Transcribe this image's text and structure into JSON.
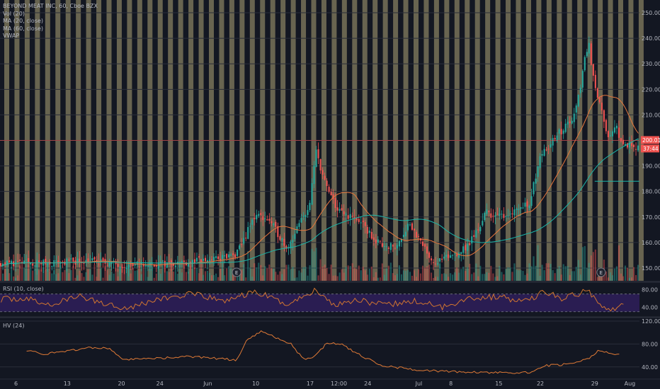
{
  "legend": {
    "symbol": "BEYOND MEAT INC, 60, Cboe BZX",
    "vol": "Vol (20)",
    "ma20": "MA (20, close)",
    "ma60": "MA (60, close)",
    "vwap": "VWAP"
  },
  "panels": {
    "rsi_label": "RSI (10, close)",
    "hv_label": "HV (24)"
  },
  "price_tags": {
    "last": "200.01",
    "countdown": "37:44"
  },
  "earnings_marker": "E",
  "colors": {
    "background": "#131722",
    "session_band": "#807a5e",
    "up": "#26a69a",
    "down": "#ef5350",
    "ma20": "#e8773c",
    "ma60": "#1bb5a7",
    "rsi_band": "#2a1d52",
    "rsi_line": "#d1752f",
    "hv_line": "#e07a36",
    "last_price": "#ef5350"
  },
  "chart_data": [
    {
      "type": "candlestick",
      "title": "BEYOND MEAT INC, 60, Cboe BZX",
      "x_ticks": [
        "6",
        "13",
        "20",
        "24",
        "Jun",
        "10",
        "17",
        "12:00",
        "24",
        "Jul",
        "8",
        "15",
        "22",
        "29",
        "Aug"
      ],
      "y_ticks": [
        "150.00",
        "160.00",
        "170.00",
        "180.00",
        "190.00",
        "200.00",
        "210.00",
        "220.00",
        "230.00",
        "240.00",
        "250.00"
      ],
      "ylim": [
        145,
        255
      ],
      "last_price": 200.01,
      "horizontal_level": 184,
      "close_keypoints": [
        [
          0,
          152
        ],
        [
          0.07,
          152
        ],
        [
          0.14,
          153
        ],
        [
          0.2,
          151
        ],
        [
          0.27,
          152
        ],
        [
          0.32,
          153
        ],
        [
          0.37,
          155
        ],
        [
          0.4,
          171
        ],
        [
          0.42,
          169
        ],
        [
          0.45,
          158
        ],
        [
          0.485,
          175
        ],
        [
          0.495,
          196
        ],
        [
          0.51,
          182
        ],
        [
          0.53,
          172
        ],
        [
          0.56,
          169
        ],
        [
          0.59,
          160
        ],
        [
          0.62,
          158
        ],
        [
          0.64,
          168
        ],
        [
          0.66,
          159
        ],
        [
          0.68,
          152
        ],
        [
          0.7,
          154
        ],
        [
          0.73,
          158
        ],
        [
          0.75,
          166
        ],
        [
          0.76,
          172
        ],
        [
          0.78,
          170
        ],
        [
          0.8,
          172
        ],
        [
          0.83,
          176
        ],
        [
          0.845,
          195
        ],
        [
          0.87,
          201
        ],
        [
          0.9,
          210
        ],
        [
          0.92,
          239
        ],
        [
          0.93,
          224
        ],
        [
          0.95,
          200
        ],
        [
          0.965,
          205
        ],
        [
          0.975,
          198
        ]
      ],
      "earnings_markers_x": [
        0.37,
        0.94
      ]
    },
    {
      "type": "line",
      "title": "RSI (10, close)",
      "y_ticks": [
        "40.00",
        "80.00"
      ],
      "ylim": [
        20,
        95
      ],
      "band": [
        30,
        70
      ],
      "keypoints": [
        [
          0,
          58
        ],
        [
          0.04,
          60
        ],
        [
          0.08,
          44
        ],
        [
          0.12,
          66
        ],
        [
          0.16,
          50
        ],
        [
          0.2,
          38
        ],
        [
          0.24,
          56
        ],
        [
          0.3,
          70
        ],
        [
          0.35,
          54
        ],
        [
          0.4,
          75
        ],
        [
          0.45,
          46
        ],
        [
          0.495,
          80
        ],
        [
          0.52,
          46
        ],
        [
          0.56,
          58
        ],
        [
          0.6,
          44
        ],
        [
          0.65,
          54
        ],
        [
          0.69,
          40
        ],
        [
          0.73,
          60
        ],
        [
          0.78,
          64
        ],
        [
          0.82,
          52
        ],
        [
          0.85,
          75
        ],
        [
          0.88,
          60
        ],
        [
          0.9,
          68
        ],
        [
          0.92,
          78
        ],
        [
          0.94,
          46
        ],
        [
          0.96,
          35
        ],
        [
          0.975,
          46
        ]
      ]
    },
    {
      "type": "line",
      "title": "HV (24)",
      "y_ticks": [
        "40.00",
        "80.00",
        "120.00"
      ],
      "ylim": [
        20,
        125
      ],
      "keypoints": [
        [
          0.04,
          70
        ],
        [
          0.07,
          62
        ],
        [
          0.1,
          67
        ],
        [
          0.14,
          74
        ],
        [
          0.17,
          72
        ],
        [
          0.195,
          52
        ],
        [
          0.24,
          55
        ],
        [
          0.3,
          58
        ],
        [
          0.37,
          52
        ],
        [
          0.385,
          85
        ],
        [
          0.41,
          103
        ],
        [
          0.43,
          92
        ],
        [
          0.455,
          80
        ],
        [
          0.475,
          53
        ],
        [
          0.49,
          57
        ],
        [
          0.51,
          80
        ],
        [
          0.53,
          82
        ],
        [
          0.56,
          62
        ],
        [
          0.6,
          42
        ],
        [
          0.65,
          35
        ],
        [
          0.7,
          32
        ],
        [
          0.76,
          30
        ],
        [
          0.83,
          30
        ],
        [
          0.85,
          42
        ],
        [
          0.89,
          45
        ],
        [
          0.92,
          54
        ],
        [
          0.935,
          68
        ],
        [
          0.955,
          65
        ],
        [
          0.97,
          60
        ]
      ]
    }
  ]
}
